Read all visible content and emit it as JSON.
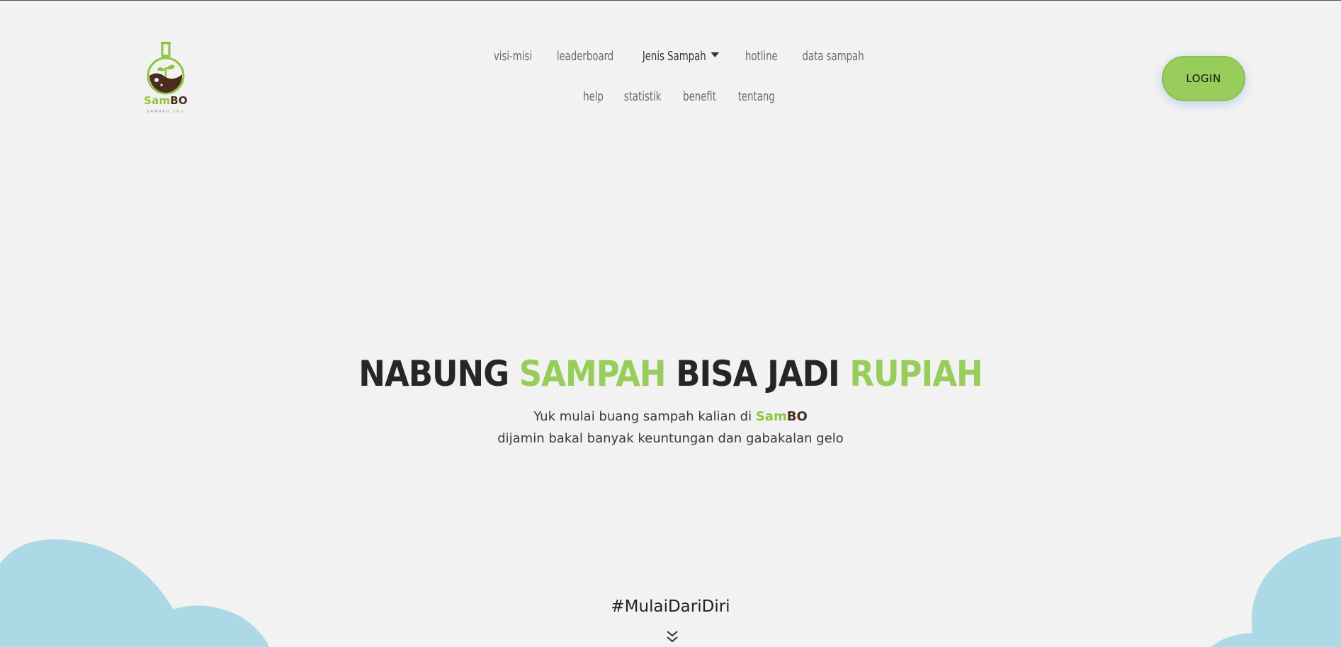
{
  "brand": {
    "name_green": "Sam",
    "name_brown": "BO",
    "tagline_1": "SAMPAH",
    "tagline_2": "BRO"
  },
  "nav": {
    "row1": [
      "visi-misi",
      "leaderboard",
      "Jenis Sampah",
      "hotline",
      "data sampah"
    ],
    "row2": [
      "help",
      "statistik",
      "benefit",
      "tentang"
    ],
    "dropdown_icon": "caret-down-icon"
  },
  "login": {
    "label": "LOGIN"
  },
  "hero": {
    "title_1": "NABUNG",
    "title_2": "SAMPAH",
    "title_3": "BISA JADI",
    "title_4": "RUPIAH",
    "sub_line1_prefix": "Yuk mulai buang sampah kalian di",
    "sub_brand_green": "Sam",
    "sub_brand_brown": "BO",
    "sub_line2": "dijamin bakal banyak keuntungan dan gabakalan gelo",
    "hashtag": "#MulaiDariDiri",
    "scroll_icon": "double-chevron-down-icon"
  },
  "colors": {
    "background": "#f2f2f2",
    "accent_green": "#98cd5c",
    "brand_brown": "#4a2c20",
    "cloud": "#add8e6",
    "text_dark": "#262628"
  }
}
